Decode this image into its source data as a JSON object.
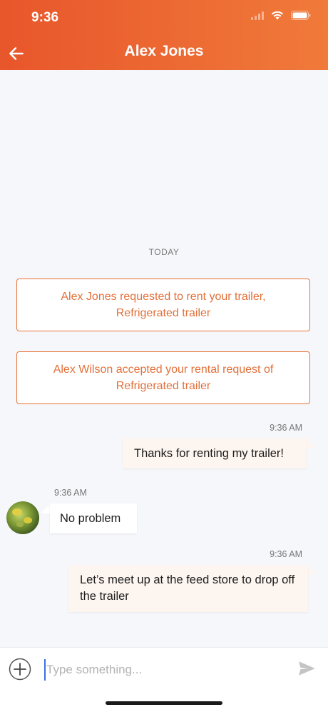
{
  "status_bar": {
    "time": "9:36",
    "icons": [
      "signal-icon",
      "wifi-icon",
      "battery-icon"
    ]
  },
  "header": {
    "title": "Alex Jones",
    "back_icon": "arrow-left-icon",
    "colors": {
      "gradient_start": "#e8562b",
      "gradient_end": "#f07a3a"
    }
  },
  "chat": {
    "day_separator": "TODAY",
    "system_notices": [
      {
        "line1": "Alex Jones requested to rent your trailer,",
        "line2": "Refrigerated trailer"
      },
      {
        "line1": "Alex Wilson accepted your rental request of",
        "line2": "Refrigerated trailer"
      }
    ],
    "messages": [
      {
        "direction": "outgoing",
        "time": "9:36 AM",
        "text": "Thanks for renting my trailer!"
      },
      {
        "direction": "incoming",
        "time": "9:36 AM",
        "text": "No problem",
        "avatar": "avatar-photo"
      },
      {
        "direction": "outgoing",
        "time": "9:36 AM",
        "text": "Let’s meet up at the feed store to drop off the trailer"
      }
    ]
  },
  "composer": {
    "placeholder": "Type something...",
    "value": "",
    "add_icon": "plus-circle-icon",
    "send_icon": "send-icon"
  },
  "colors": {
    "accent": "#e8743a",
    "outgoing_bubble": "#fdf5ef",
    "background": "#f6f7fb"
  }
}
